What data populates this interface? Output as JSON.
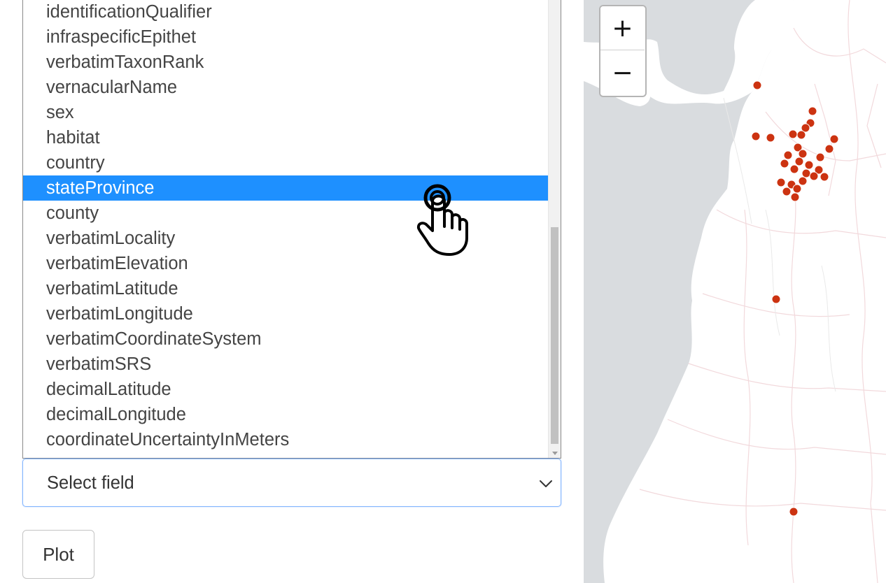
{
  "field_list": {
    "options": [
      "identificationQualifier",
      "infraspecificEpithet",
      "verbatimTaxonRank",
      "vernacularName",
      "sex",
      "habitat",
      "country",
      "stateProvince",
      "county",
      "verbatimLocality",
      "verbatimElevation",
      "verbatimLatitude",
      "verbatimLongitude",
      "verbatimCoordinateSystem",
      "verbatimSRS",
      "decimalLatitude",
      "decimalLongitude",
      "coordinateUncertaintyInMeters"
    ],
    "highlighted": "stateProvince"
  },
  "select": {
    "value": "Select field"
  },
  "plot_button": {
    "label": "Plot"
  },
  "map": {
    "zoom_in_label": "+",
    "zoom_out_label": "−",
    "marker_color": "#cc3311",
    "land_color": "#ffffff",
    "water_color": "#d9dcdf"
  },
  "colors": {
    "selection_bg": "#1e90ff",
    "focus_border": "#86b7fe"
  }
}
